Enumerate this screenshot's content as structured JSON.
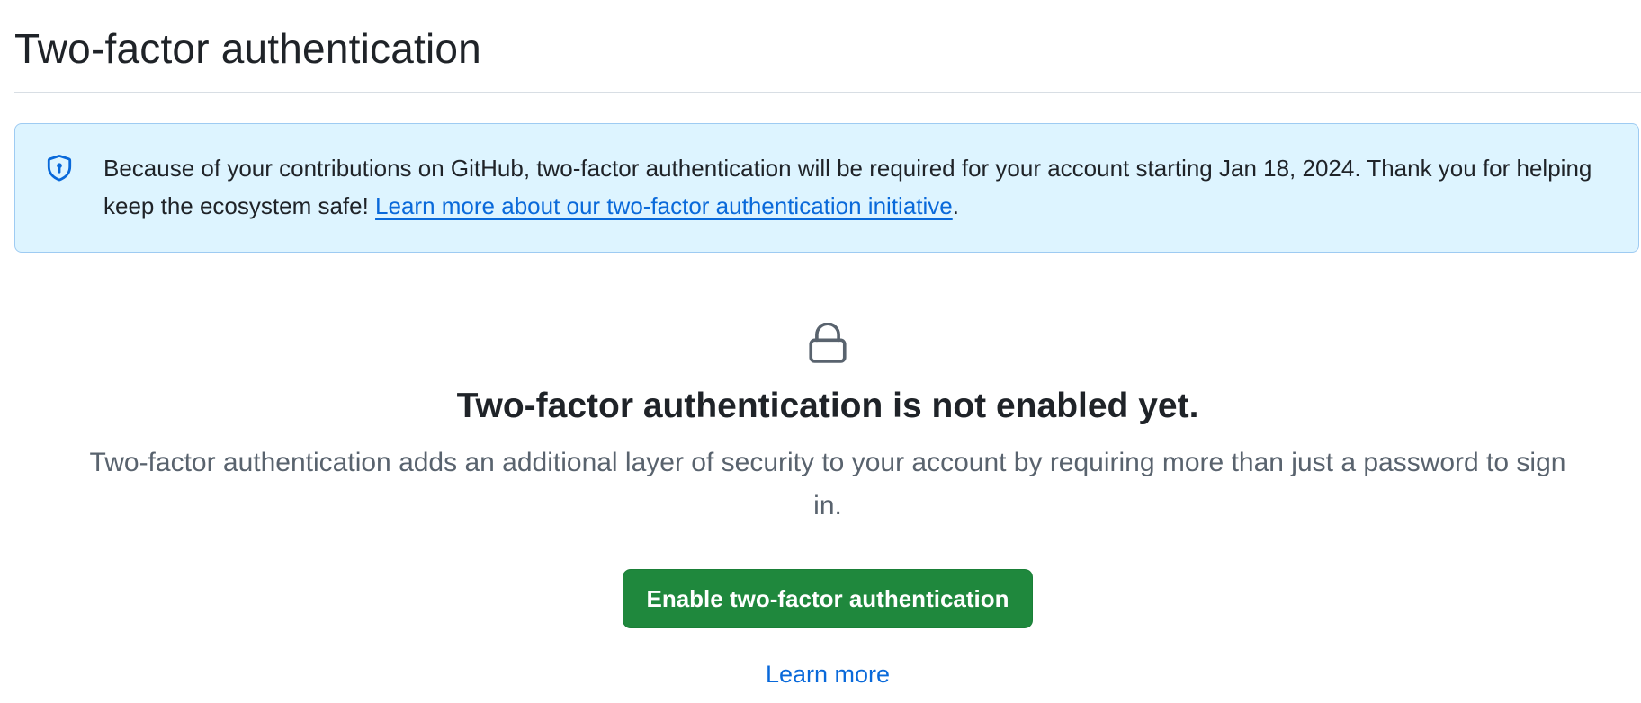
{
  "page": {
    "title": "Two-factor authentication"
  },
  "flash": {
    "icon": "shield-lock-icon",
    "message": "Because of your contributions on GitHub, two-factor authentication will be required for your account starting Jan 18, 2024. Thank you for helping keep the ecosystem safe! ",
    "link_text": "Learn more about our two-factor authentication initiative",
    "suffix": ".",
    "bg_color": "#ddf4ff",
    "border_color": "#9ecbf2"
  },
  "blankslate": {
    "icon": "lock-icon",
    "heading": "Two-factor authentication is not enabled yet.",
    "description": "Two-factor authentication adds an additional layer of security to your account by requiring more than just a password to sign in.",
    "primary_button": "Enable two-factor authentication",
    "secondary_link": "Learn more"
  },
  "colors": {
    "primary_button": "#1f883d",
    "link": "#0969da",
    "muted_text": "#59636e"
  }
}
